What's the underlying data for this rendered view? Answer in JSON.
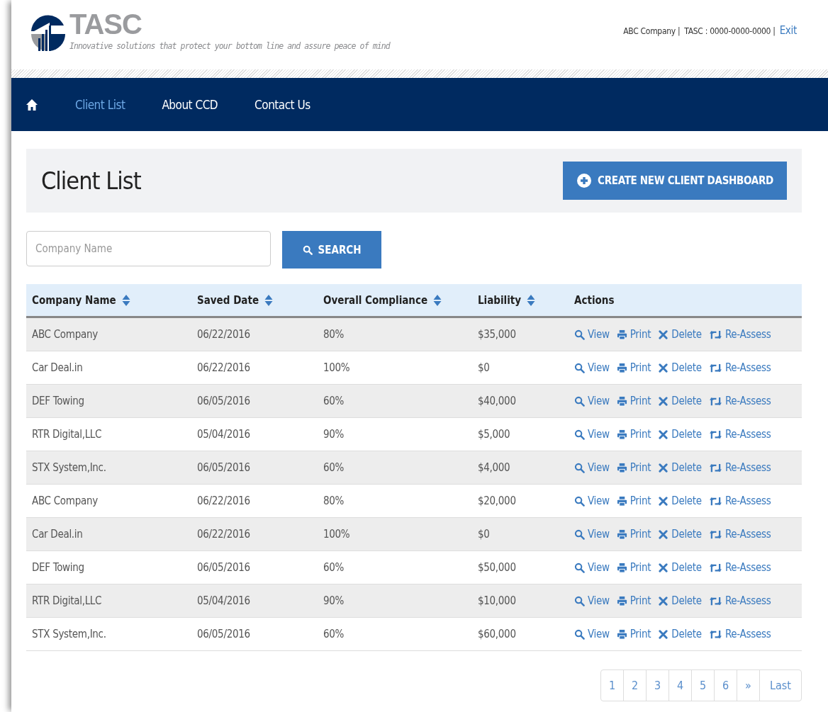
{
  "header": {
    "logo_text": "TASC",
    "tagline": "Innovative solutions that protect your bottom line and assure peace of mind",
    "company": "ABC Company |",
    "account": "TASC : 0000-0000-0000 |",
    "exit": "Exit"
  },
  "nav": [
    {
      "label": "Client List",
      "selected": true
    },
    {
      "label": "About CCD",
      "selected": false
    },
    {
      "label": "Contact Us",
      "selected": false
    }
  ],
  "page_title": "Client List",
  "create_button": "CREATE NEW CLIENT DASHBOARD",
  "search": {
    "placeholder": "Company Name",
    "button": "SEARCH"
  },
  "table": {
    "columns": [
      {
        "label": "Company Name",
        "sortable": true
      },
      {
        "label": "Saved Date",
        "sortable": true
      },
      {
        "label": "Overall Compliance",
        "sortable": true
      },
      {
        "label": "Liability",
        "sortable": true
      },
      {
        "label": "Actions",
        "sortable": false
      }
    ],
    "rows": [
      {
        "cells": [
          "ABC Company",
          "06/22/2016",
          "80%",
          "$35,000"
        ],
        "actions": [
          {
            "kind": "view",
            "label": "View"
          },
          {
            "kind": "print",
            "label": "Print"
          },
          {
            "kind": "delete",
            "label": "Delete"
          },
          {
            "kind": "reassess",
            "label": "Re-Assess"
          }
        ]
      },
      {
        "cells": [
          "Car Deal.in",
          "06/22/2016",
          "100%",
          "$0"
        ],
        "actions": [
          {
            "kind": "view",
            "label": "View"
          },
          {
            "kind": "print",
            "label": "Print"
          },
          {
            "kind": "delete",
            "label": "Delete"
          },
          {
            "kind": "reassess",
            "label": "Re-Assess"
          }
        ]
      },
      {
        "cells": [
          "DEF Towing",
          "06/05/2016",
          "60%",
          "$40,000"
        ],
        "actions": [
          {
            "kind": "view",
            "label": "View"
          },
          {
            "kind": "print",
            "label": "Print"
          },
          {
            "kind": "delete",
            "label": "Delete"
          },
          {
            "kind": "reassess",
            "label": "Re-Assess"
          }
        ]
      },
      {
        "cells": [
          "RTR Digital,LLC",
          "05/04/2016",
          "90%",
          "$5,000"
        ],
        "actions": [
          {
            "kind": "view",
            "label": "View"
          },
          {
            "kind": "print",
            "label": "Print"
          },
          {
            "kind": "delete",
            "label": "Delete"
          },
          {
            "kind": "reassess",
            "label": "Re-Assess"
          }
        ]
      },
      {
        "cells": [
          "STX System,Inc.",
          "06/05/2016",
          "60%",
          "$4,000"
        ],
        "actions": [
          {
            "kind": "view",
            "label": "View"
          },
          {
            "kind": "print",
            "label": "Print"
          },
          {
            "kind": "delete",
            "label": "Delete"
          },
          {
            "kind": "reassess",
            "label": "Re-Assess"
          }
        ]
      },
      {
        "cells": [
          "ABC Company",
          "06/22/2016",
          "80%",
          "$20,000"
        ],
        "actions": [
          {
            "kind": "view",
            "label": "View"
          },
          {
            "kind": "print",
            "label": "Print"
          },
          {
            "kind": "delete",
            "label": "Delete"
          },
          {
            "kind": "reassess",
            "label": "Re-Assess"
          }
        ]
      },
      {
        "cells": [
          "Car Deal.in",
          "06/22/2016",
          "100%",
          "$0"
        ],
        "actions": [
          {
            "kind": "view",
            "label": "View"
          },
          {
            "kind": "print",
            "label": "Print"
          },
          {
            "kind": "delete",
            "label": "Delete"
          },
          {
            "kind": "reassess",
            "label": "Re-Assess"
          }
        ]
      },
      {
        "cells": [
          "DEF Towing",
          "06/05/2016",
          "60%",
          "$50,000"
        ],
        "actions": [
          {
            "kind": "view",
            "label": "View"
          },
          {
            "kind": "print",
            "label": "Print"
          },
          {
            "kind": "delete",
            "label": "Delete"
          },
          {
            "kind": "reassess",
            "label": "Re-Assess"
          }
        ]
      },
      {
        "cells": [
          "RTR Digital,LLC",
          "05/04/2016",
          "90%",
          "$10,000"
        ],
        "actions": [
          {
            "kind": "view",
            "label": "View"
          },
          {
            "kind": "print",
            "label": "Print"
          },
          {
            "kind": "delete",
            "label": "Delete"
          },
          {
            "kind": "reassess",
            "label": "Re-Assess"
          }
        ]
      },
      {
        "cells": [
          "STX System,Inc.",
          "06/05/2016",
          "60%",
          "$60,000"
        ],
        "actions": [
          {
            "kind": "view",
            "label": "View"
          },
          {
            "kind": "print",
            "label": "Print"
          },
          {
            "kind": "delete",
            "label": "Delete"
          },
          {
            "kind": "reassess",
            "label": "Re-Assess"
          }
        ]
      }
    ]
  },
  "pagination": [
    "1",
    "2",
    "3",
    "4",
    "5",
    "6",
    "»",
    "Last"
  ]
}
